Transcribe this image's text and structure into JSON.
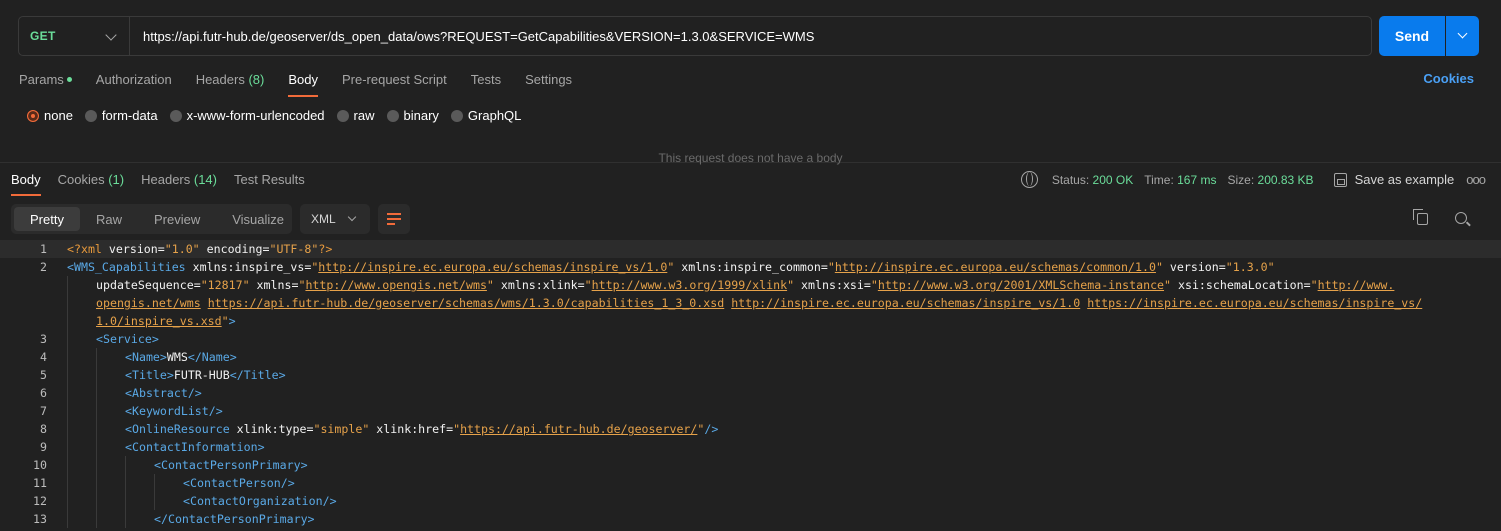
{
  "request": {
    "method": "GET",
    "url": "https://api.futr-hub.de/geoserver/ds_open_data/ows?REQUEST=GetCapabilities&VERSION=1.3.0&SERVICE=WMS",
    "send_label": "Send"
  },
  "request_tabs": [
    {
      "label": "Params",
      "dot": true
    },
    {
      "label": "Authorization"
    },
    {
      "label": "Headers",
      "count": "(8)"
    },
    {
      "label": "Body",
      "active": true
    },
    {
      "label": "Pre-request Script"
    },
    {
      "label": "Tests"
    },
    {
      "label": "Settings"
    }
  ],
  "cookies_label": "Cookies",
  "body_types": [
    {
      "label": "none",
      "selected": true
    },
    {
      "label": "form-data"
    },
    {
      "label": "x-www-form-urlencoded"
    },
    {
      "label": "raw"
    },
    {
      "label": "binary"
    },
    {
      "label": "GraphQL"
    }
  ],
  "no_body_message": "This request does not have a body",
  "response_tabs": [
    {
      "label": "Body",
      "active": true
    },
    {
      "label": "Cookies",
      "count": "(1)"
    },
    {
      "label": "Headers",
      "count": "(14)"
    },
    {
      "label": "Test Results"
    }
  ],
  "status": {
    "status_label": "Status:",
    "status_value": "200 OK",
    "time_label": "Time:",
    "time_value": "167 ms",
    "size_label": "Size:",
    "size_value": "200.83 KB",
    "save_label": "Save as example",
    "more_label": "ooo"
  },
  "view_modes": [
    "Pretty",
    "Raw",
    "Preview",
    "Visualize"
  ],
  "active_view": "Pretty",
  "format": "XML",
  "colors": {
    "accent": "#f26b3a",
    "send": "#097bed",
    "success": "#6bdd9a",
    "link": "#4aa0f5"
  },
  "code_lines": [
    {
      "n": "1",
      "indent": 0,
      "hl": true,
      "tokens": [
        [
          "pi",
          "<?"
        ],
        [
          "pi",
          "xml"
        ],
        [
          "attr",
          " version="
        ],
        [
          "str",
          "\"1.0\""
        ],
        [
          "attr",
          " encoding="
        ],
        [
          "str",
          "\"UTF-8\""
        ],
        [
          "pi",
          "?>"
        ]
      ]
    },
    {
      "n": "2",
      "indent": 0,
      "tokens": [
        [
          "tag",
          "<WMS_Capabilities"
        ],
        [
          "attr",
          " xmlns:inspire_vs="
        ],
        [
          "str",
          "\""
        ],
        [
          "url",
          "http://inspire.ec.europa.eu/schemas/inspire_vs/1.0"
        ],
        [
          "str",
          "\""
        ],
        [
          "attr",
          " xmlns:inspire_common="
        ],
        [
          "str",
          "\""
        ],
        [
          "url",
          "http://inspire.ec.europa.eu/schemas/common/1.0"
        ],
        [
          "str",
          "\""
        ],
        [
          "attr",
          " version="
        ],
        [
          "str",
          "\"1.3.0\""
        ]
      ]
    },
    {
      "n": "",
      "indent": 1,
      "tokens": [
        [
          "attr",
          "updateSequence="
        ],
        [
          "str",
          "\"12817\""
        ],
        [
          "attr",
          " xmlns="
        ],
        [
          "str",
          "\""
        ],
        [
          "url",
          "http://www.opengis.net/wms"
        ],
        [
          "str",
          "\""
        ],
        [
          "attr",
          " xmlns:xlink="
        ],
        [
          "str",
          "\""
        ],
        [
          "url",
          "http://www.w3.org/1999/xlink"
        ],
        [
          "str",
          "\""
        ],
        [
          "attr",
          " xmlns:xsi="
        ],
        [
          "str",
          "\""
        ],
        [
          "url",
          "http://www.w3.org/2001/XMLSchema-instance"
        ],
        [
          "str",
          "\""
        ],
        [
          "attr",
          " xsi:schemaLocation="
        ],
        [
          "str",
          "\""
        ],
        [
          "url",
          "http://www."
        ]
      ]
    },
    {
      "n": "",
      "indent": 1,
      "tokens": [
        [
          "url",
          "opengis.net/wms"
        ],
        [
          "str",
          " "
        ],
        [
          "url",
          "https://api.futr-hub.de/geoserver/schemas/wms/1.3.0/capabilities_1_3_0.xsd"
        ],
        [
          "str",
          " "
        ],
        [
          "url",
          "http://inspire.ec.europa.eu/schemas/inspire_vs/1.0"
        ],
        [
          "str",
          " "
        ],
        [
          "url",
          "https://inspire.ec.europa.eu/schemas/inspire_vs/"
        ]
      ]
    },
    {
      "n": "",
      "indent": 1,
      "tokens": [
        [
          "url",
          "1.0/inspire_vs.xsd"
        ],
        [
          "str",
          "\""
        ],
        [
          "tag",
          ">"
        ]
      ]
    },
    {
      "n": "3",
      "indent": 1,
      "tokens": [
        [
          "tag",
          "<Service>"
        ]
      ]
    },
    {
      "n": "4",
      "indent": 2,
      "tokens": [
        [
          "tag",
          "<Name>"
        ],
        [
          "text",
          "WMS"
        ],
        [
          "tag",
          "</Name>"
        ]
      ]
    },
    {
      "n": "5",
      "indent": 2,
      "tokens": [
        [
          "tag",
          "<Title>"
        ],
        [
          "text",
          "FUTR-HUB"
        ],
        [
          "tag",
          "</Title>"
        ]
      ]
    },
    {
      "n": "6",
      "indent": 2,
      "tokens": [
        [
          "tag",
          "<Abstract/>"
        ]
      ]
    },
    {
      "n": "7",
      "indent": 2,
      "tokens": [
        [
          "tag",
          "<KeywordList/>"
        ]
      ]
    },
    {
      "n": "8",
      "indent": 2,
      "tokens": [
        [
          "tag",
          "<OnlineResource"
        ],
        [
          "attr",
          " xlink:type="
        ],
        [
          "str",
          "\"simple\""
        ],
        [
          "attr",
          " xlink:href="
        ],
        [
          "str",
          "\""
        ],
        [
          "url",
          "https://api.futr-hub.de/geoserver/"
        ],
        [
          "str",
          "\""
        ],
        [
          "tag",
          "/>"
        ]
      ]
    },
    {
      "n": "9",
      "indent": 2,
      "tokens": [
        [
          "tag",
          "<ContactInformation>"
        ]
      ]
    },
    {
      "n": "10",
      "indent": 3,
      "tokens": [
        [
          "tag",
          "<ContactPersonPrimary>"
        ]
      ]
    },
    {
      "n": "11",
      "indent": 4,
      "tokens": [
        [
          "tag",
          "<ContactPerson/>"
        ]
      ]
    },
    {
      "n": "12",
      "indent": 4,
      "tokens": [
        [
          "tag",
          "<ContactOrganization/>"
        ]
      ]
    },
    {
      "n": "13",
      "indent": 3,
      "tokens": [
        [
          "tag",
          "</ContactPersonPrimary>"
        ]
      ]
    }
  ]
}
